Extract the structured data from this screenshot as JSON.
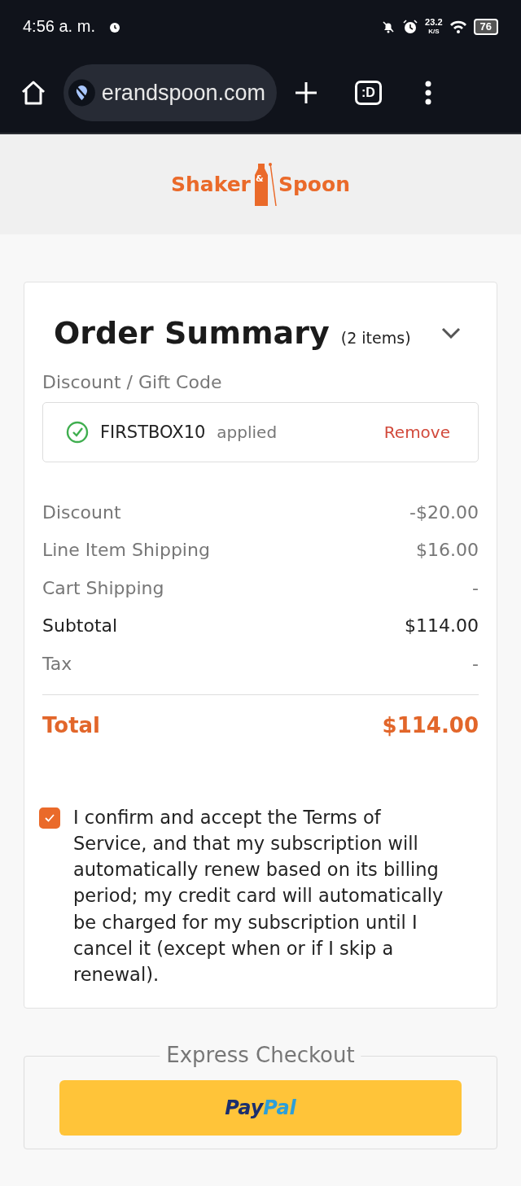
{
  "status_bar": {
    "time": "4:56 a. m.",
    "speed": "23.2",
    "speed_unit": "K/S",
    "battery": "76"
  },
  "browser": {
    "url": "erandspoon.com",
    "tab_switcher": ":D"
  },
  "logo": {
    "word_1": "Shaker",
    "ampersand": "&",
    "word_2": "Spoon"
  },
  "order_summary": {
    "title": "Order Summary",
    "count": "(2 items)",
    "expanded": false,
    "discount_label": "Discount / Gift Code",
    "code": {
      "value": "FIRSTBOX10",
      "status": "applied",
      "action": "Remove"
    },
    "lines": [
      {
        "label": "Discount",
        "value": "-$20.00",
        "kind": "muted"
      },
      {
        "label": "Line Item Shipping",
        "value": "$16.00",
        "kind": "muted"
      },
      {
        "label": "Cart Shipping",
        "value": "-",
        "kind": "muted"
      },
      {
        "label": "Subtotal",
        "value": "$114.00",
        "kind": "strong"
      },
      {
        "label": "Tax",
        "value": "-",
        "kind": "muted"
      }
    ],
    "total": {
      "label": "Total",
      "value": "$114.00"
    },
    "terms": {
      "checked": true,
      "text": "I confirm and accept the Terms of Service, and that my subscription will automatically renew based on its billing period; my credit card will automatically be charged for my subscription until I cancel it (except when or if I skip a renewal)."
    }
  },
  "express_checkout": {
    "title": "Express Checkout",
    "paypal": {
      "part_1": "Pay",
      "part_2": "Pal"
    }
  }
}
